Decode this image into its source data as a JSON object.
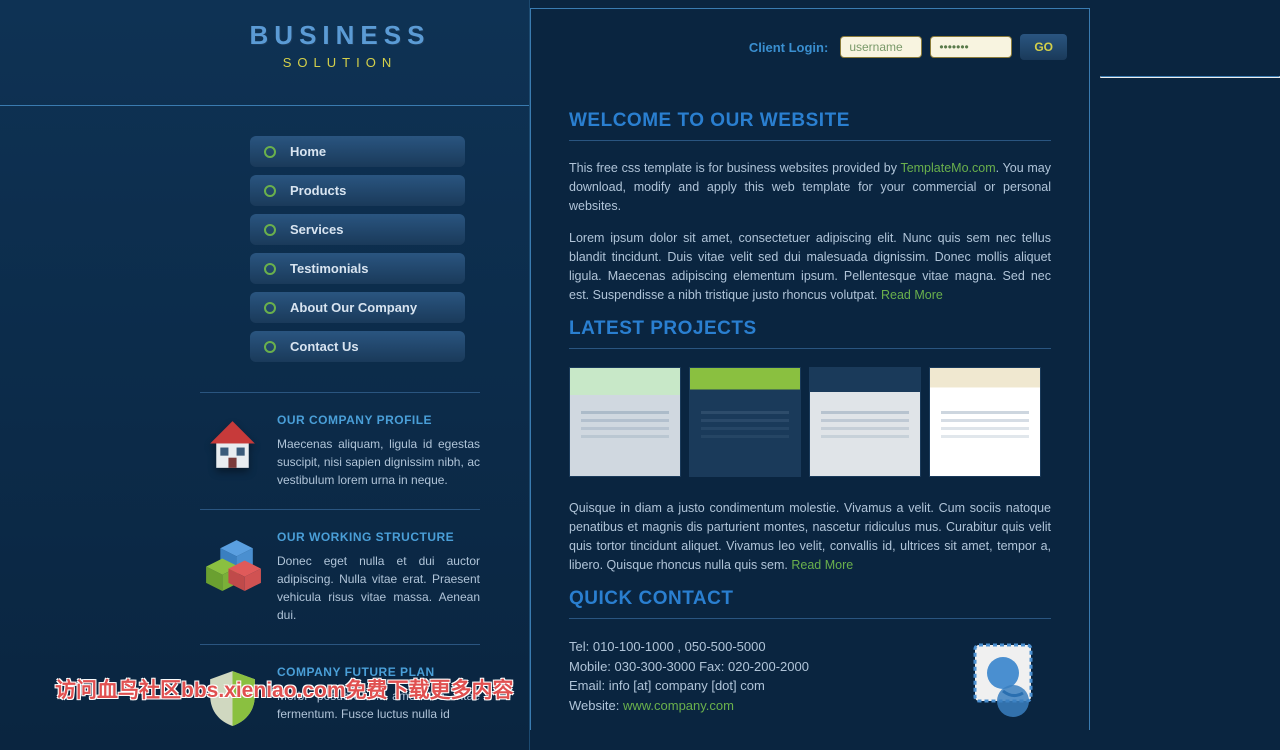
{
  "logo": {
    "title": "BUSINESS",
    "subtitle": "SOLUTION"
  },
  "nav": [
    {
      "label": "Home"
    },
    {
      "label": "Products"
    },
    {
      "label": "Services"
    },
    {
      "label": "Testimonials"
    },
    {
      "label": "About Our Company"
    },
    {
      "label": "Contact Us"
    }
  ],
  "sidebar_blocks": [
    {
      "title": "OUR COMPANY PROFILE",
      "body": "Maecenas aliquam, ligula id egestas suscipit, nisi sapien dignissim nibh, ac vestibulum lorem urna in neque."
    },
    {
      "title": "OUR WORKING STRUCTURE",
      "body": "Donec eget nulla et dui auctor adipiscing. Nulla vitae erat. Praesent vehicula risus vitae massa. Aenean dui."
    },
    {
      "title": "COMPANY FUTURE PLAN",
      "body": "Morbi posuere sit amet leo vitae fermentum. Fusce luctus nulla id"
    }
  ],
  "login": {
    "label": "Client Login:",
    "username_placeholder": "username",
    "password_value": "•••••••",
    "go": "GO"
  },
  "headings": {
    "welcome": "WELCOME TO OUR WEBSITE",
    "projects": "LATEST PROJECTS",
    "contact": "QUICK CONTACT"
  },
  "welcome": {
    "p1_prefix": "This free css template is for business websites provided by ",
    "p1_link": "TemplateMo.com",
    "p1_suffix": ". You may download, modify and apply this web template for your commercial or personal websites.",
    "p2": "Lorem ipsum dolor sit amet, consectetuer adipiscing elit. Nunc quis sem nec tellus blandit tincidunt. Duis vitae velit sed dui malesuada dignissim. Donec mollis aliquet ligula. Maecenas adipiscing elementum ipsum. Pellentesque vitae magna. Sed nec est. Suspendisse a nibh tristique justo rhoncus volutpat. ",
    "read_more": "Read More"
  },
  "projects_p": "Quisque in diam a justo condimentum molestie. Vivamus a velit. Cum sociis natoque penatibus et magnis dis parturient montes, nascetur ridiculus mus. Curabitur quis velit quis tortor tincidunt aliquet. Vivamus leo velit, convallis id, ultrices sit amet, tempor a, libero. Quisque rhoncus nulla quis sem. ",
  "projects_read_more": "Read More",
  "contact": {
    "line1": "Tel: 010-100-1000 , 050-500-5000",
    "line2": "Mobile: 030-300-3000 Fax: 020-200-2000",
    "line3_prefix": "Email: info [at] company [dot] com",
    "line4_prefix": "Website: ",
    "line4_link": "www.company.com"
  },
  "watermark": "访问血鸟社区bbs.xieniao.com免费下载更多内容"
}
